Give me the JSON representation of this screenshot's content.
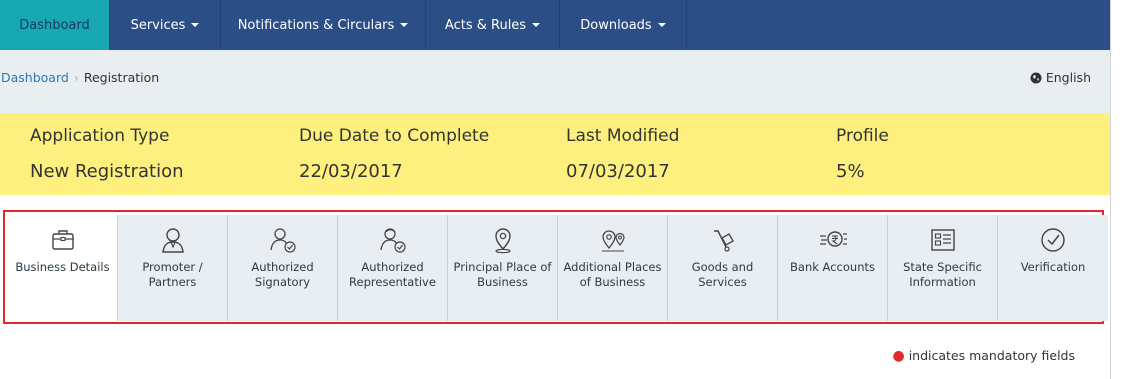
{
  "nav": {
    "items": [
      {
        "label": "Dashboard",
        "dropdown": false
      },
      {
        "label": "Services",
        "dropdown": true
      },
      {
        "label": "Notifications & Circulars",
        "dropdown": true
      },
      {
        "label": "Acts & Rules",
        "dropdown": true
      },
      {
        "label": "Downloads",
        "dropdown": true
      }
    ]
  },
  "breadcrumb": {
    "home": "Dashboard",
    "current": "Registration"
  },
  "language": "English",
  "summary": {
    "application_type_label": "Application Type",
    "application_type_value": "New Registration",
    "due_date_label": "Due Date to Complete",
    "due_date_value": "22/03/2017",
    "last_modified_label": "Last Modified",
    "last_modified_value": "07/03/2017",
    "profile_label": "Profile",
    "profile_value": "5%"
  },
  "tabs": [
    {
      "label": "Business Details",
      "icon": "briefcase-icon"
    },
    {
      "label": "Promoter / Partners",
      "icon": "person-icon"
    },
    {
      "label": "Authorized Signatory",
      "icon": "signatory-icon"
    },
    {
      "label": "Authorized Representative",
      "icon": "representative-icon"
    },
    {
      "label": "Principal Place of Business",
      "icon": "map-pin-icon"
    },
    {
      "label": "Additional Places of Business",
      "icon": "multi-pin-icon"
    },
    {
      "label": "Goods and Services",
      "icon": "trolley-icon"
    },
    {
      "label": "Bank Accounts",
      "icon": "rupee-coin-icon"
    },
    {
      "label": "State Specific Information",
      "icon": "info-card-icon"
    },
    {
      "label": "Verification",
      "icon": "check-circle-icon"
    }
  ],
  "mandatory_note": "indicates mandatory fields"
}
